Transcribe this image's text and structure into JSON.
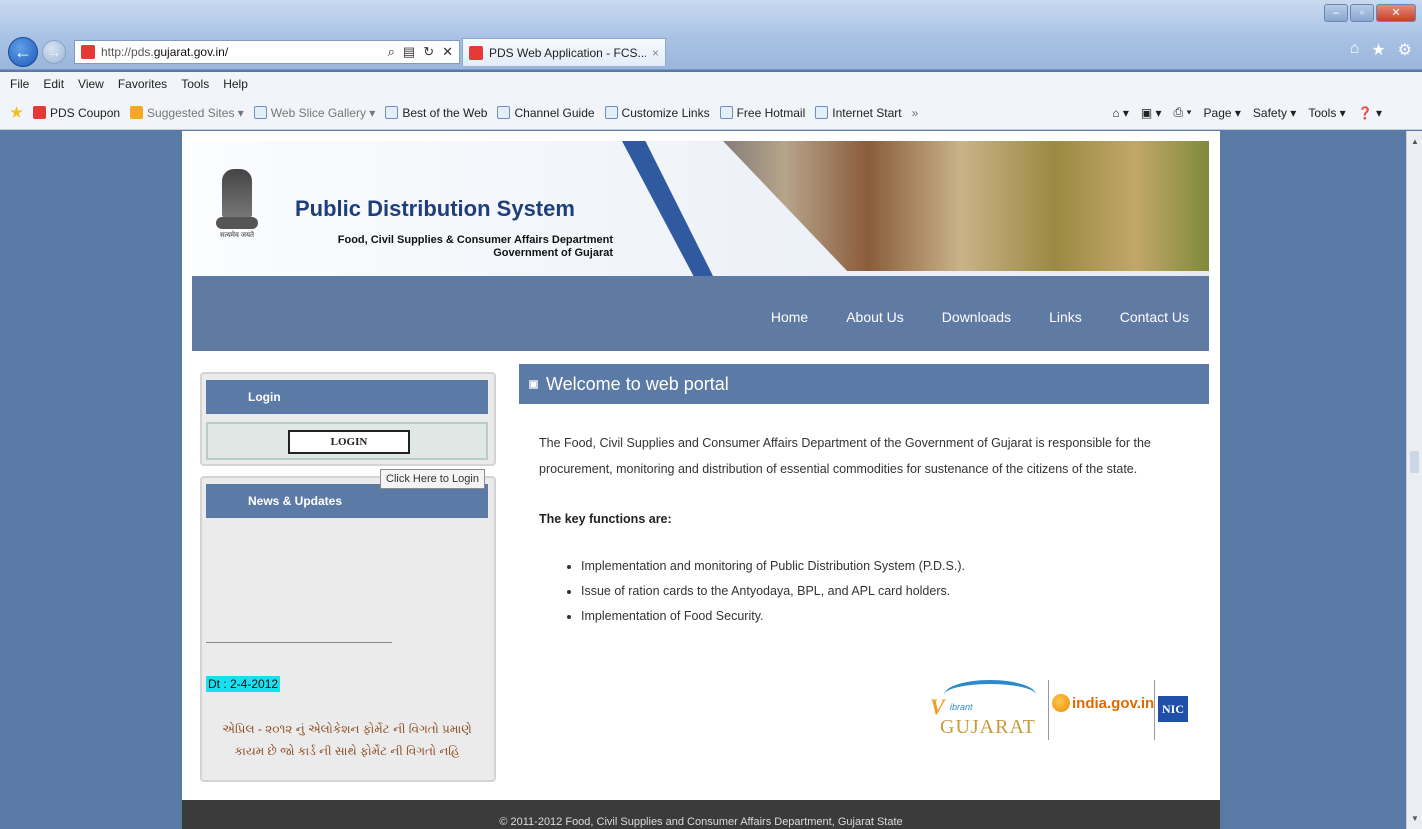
{
  "browser": {
    "url_prefix": "http://pds.",
    "url_domain": "gujarat.gov.in/",
    "tab_title": "PDS Web Application - FCS...",
    "tab_close": "×",
    "menu": [
      "File",
      "Edit",
      "View",
      "Favorites",
      "Tools",
      "Help"
    ],
    "favorites": [
      {
        "label": "PDS Coupon",
        "icon": "pds-icon"
      },
      {
        "label": "Suggested Sites ▾",
        "icon": "suggested-icon",
        "muted": true
      },
      {
        "label": "Web Slice Gallery ▾",
        "icon": "ie-icon",
        "muted": true
      },
      {
        "label": "Best of the Web",
        "icon": "ie-icon"
      },
      {
        "label": "Channel Guide",
        "icon": "ie-icon"
      },
      {
        "label": "Customize Links",
        "icon": "ie-icon"
      },
      {
        "label": "Free Hotmail",
        "icon": "ie-icon"
      },
      {
        "label": "Internet Start",
        "icon": "ie-icon"
      }
    ],
    "overflow": "»",
    "tools": [
      "Page ▾",
      "Safety ▾",
      "Tools ▾",
      "❓ ▾"
    ]
  },
  "site": {
    "title": "Public Distribution System",
    "dept_line1": "Food, Civil Supplies & Consumer Affairs Department",
    "dept_line2": "Government of Gujarat",
    "emblem_motto": "सत्यमेव जयते",
    "nav": [
      "Home",
      "About Us",
      "Downloads",
      "Links",
      "Contact Us"
    ]
  },
  "login": {
    "header": "Login",
    "button": "LOGIN",
    "tooltip": "Click Here to Login"
  },
  "news": {
    "header": "News & Updates",
    "date": "Dt : 2-4-2012",
    "text": "એપ્રિલ - ૨૦૧૨ નું એલોકેશન ફોર્મેટ ની વિગતો પ્રમાણે કાયમ છે જો કાર્ડ ની સાથે ફોર્મેટ ની વિગતો નહિ"
  },
  "welcome": {
    "title": "Welcome to web portal",
    "intro": "The Food, Civil Supplies and Consumer Affairs Department of the Government of Gujarat is responsible for the procurement, monitoring and distribution of essential commodities for sustenance of the citizens of the state.",
    "key_heading": "The key functions are:",
    "functions": [
      "Implementation and monitoring of Public Distribution System (P.D.S.).",
      "Issue of ration cards to the Antyodaya, BPL, and APL card holders.",
      "Implementation of Food Security."
    ]
  },
  "logos": {
    "vibrant_v": "V",
    "vibrant_word": "ibrant",
    "gujarat": "GUJARAT",
    "india_gov": "india.gov.in",
    "nic": "NIC"
  },
  "footer": {
    "text": "© 2011-2012 Food, Civil Supplies and Consumer Affairs Department, Gujarat State"
  }
}
